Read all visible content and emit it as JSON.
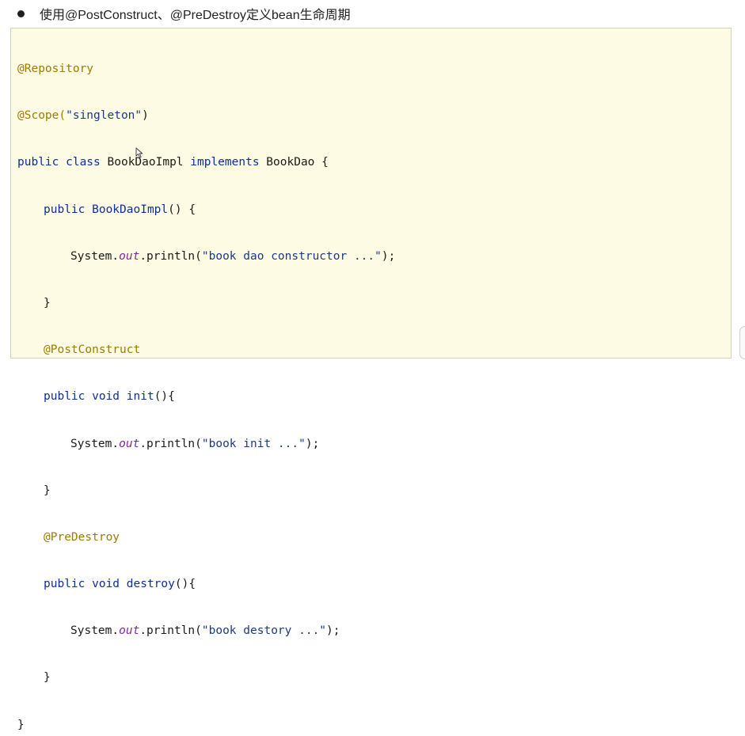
{
  "heading": {
    "text": "使用@PostConstruct、@PreDestroy定义bean生命周期"
  },
  "code": {
    "l1_ann": "@Repository",
    "l2_ann": "@Scope(",
    "l2_str": "\"singleton\"",
    "l2_end": ")",
    "l3_kw": "public class ",
    "l3_name": "BookDaoImpl ",
    "l3_kw2": "implements ",
    "l3_rest": "BookDao {",
    "l4_kw": "public ",
    "l4_name": "BookDaoImpl",
    "l4_rest": "() {",
    "l5_pre": "System.",
    "l5_field": "out",
    "l5_call": ".println(",
    "l5_str": "\"book dao constructor ...\"",
    "l5_end": ");",
    "l6": "}",
    "l7_ann": "@PostConstruct",
    "l8_kw": "public void ",
    "l8_name": "init",
    "l8_rest": "(){",
    "l9_pre": "System.",
    "l9_field": "out",
    "l9_call": ".println(",
    "l9_str": "\"book init ...\"",
    "l9_end": ");",
    "l10": "}",
    "l11_ann": "@PreDestroy",
    "l12_kw": "public void ",
    "l12_name": "destroy",
    "l12_rest": "(){",
    "l13_pre": "System.",
    "l13_field": "out",
    "l13_call": ".println(",
    "l13_str": "\"book destory ...\"",
    "l13_end": ");",
    "l14": "}",
    "l15": "}"
  },
  "colors": {
    "annotation": "#9b7c00",
    "keyword": "#0b2f9e",
    "field": "#7d2a9c",
    "code_background": "#fdfbe3"
  },
  "icons": {
    "cursor": "mouse-pointer-icon"
  }
}
